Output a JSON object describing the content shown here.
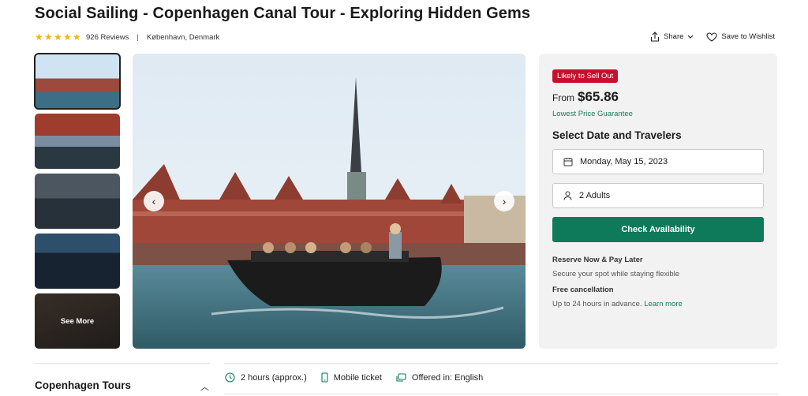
{
  "header": {
    "title": "Social Sailing - Copenhagen Canal Tour - Exploring Hidden Gems",
    "reviews": "926 Reviews",
    "separator": "|",
    "location": "København, Denmark",
    "share_label": "Share",
    "wishlist_label": "Save to Wishlist",
    "rating_stars": 5
  },
  "gallery": {
    "see_more_label": "See More"
  },
  "booking": {
    "badge": "Likely to Sell Out",
    "from_label": "From",
    "price": "$65.86",
    "guarantee": "Lowest Price Guarantee",
    "select_title": "Select Date and Travelers",
    "date_value": "Monday, May 15, 2023",
    "travelers_value": "2 Adults",
    "check_button": "Check Availability",
    "reserve_head": "Reserve Now & Pay Later",
    "reserve_text": "Secure your spot while staying flexible",
    "cancel_head": "Free cancellation",
    "cancel_text": "Up to 24 hours in advance.",
    "learn_more": "Learn more"
  },
  "details": {
    "section_title": "Copenhagen Tours",
    "duration": "2 hours (approx.)",
    "ticket": "Mobile ticket",
    "language": "Offered in: English"
  },
  "colors": {
    "star": "#f3b01c",
    "badge": "#c8102e",
    "primary": "#0e7a59",
    "link": "#1a7b58"
  }
}
